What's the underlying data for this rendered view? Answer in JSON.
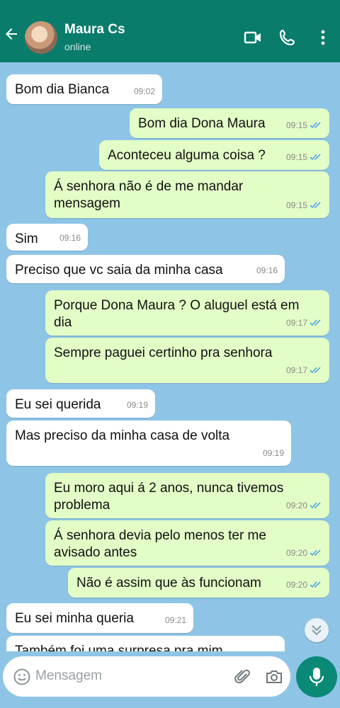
{
  "header": {
    "contact_name": "Maura Cs",
    "status": "online"
  },
  "messages": [
    {
      "dir": "in",
      "text": "Bom dia Bianca",
      "time": "09:02"
    },
    {
      "dir": "out",
      "text": "Bom dia Dona Maura",
      "time": "09:15"
    },
    {
      "dir": "out",
      "text": "Aconteceu alguma coisa ?",
      "time": "09:15"
    },
    {
      "dir": "out",
      "text": "Á senhora não é de me mandar\nmensagem",
      "time": "09:15"
    },
    {
      "dir": "in",
      "text": "Sim",
      "time": "09:16"
    },
    {
      "dir": "in",
      "text": "Preciso que vc saia da minha casa",
      "time": "09:16"
    },
    {
      "dir": "out",
      "text": "Porque Dona Maura ? O aluguel está em\ndia",
      "time": "09:17"
    },
    {
      "dir": "out",
      "text": "Sempre paguei certinho pra senhora",
      "time": "09:17"
    },
    {
      "dir": "in",
      "text": "Eu sei querida",
      "time": "09:19"
    },
    {
      "dir": "in",
      "text": "Mas preciso da minha casa de volta",
      "time": "09:19"
    },
    {
      "dir": "out",
      "text": "Eu moro aqui á 2 anos, nunca tivemos\nproblema",
      "time": "09:20"
    },
    {
      "dir": "out",
      "text": "Á senhora devia pelo menos ter me\navisado antes",
      "time": "09:20"
    },
    {
      "dir": "out",
      "text": "Não é assim que às funcionam",
      "time": "09:20"
    },
    {
      "dir": "in",
      "text": "Eu sei minha queria",
      "time": "09:21"
    },
    {
      "dir": "in",
      "text": "Também foi uma surpresa pra mim",
      "time": ""
    }
  ],
  "composer": {
    "placeholder": "Mensagem"
  },
  "colors": {
    "header": "#0a7c6b",
    "incoming": "#ffffff",
    "outgoing": "#e2fdc6",
    "read_ticks": "#4fa8e0",
    "mic": "#0a8a76"
  }
}
